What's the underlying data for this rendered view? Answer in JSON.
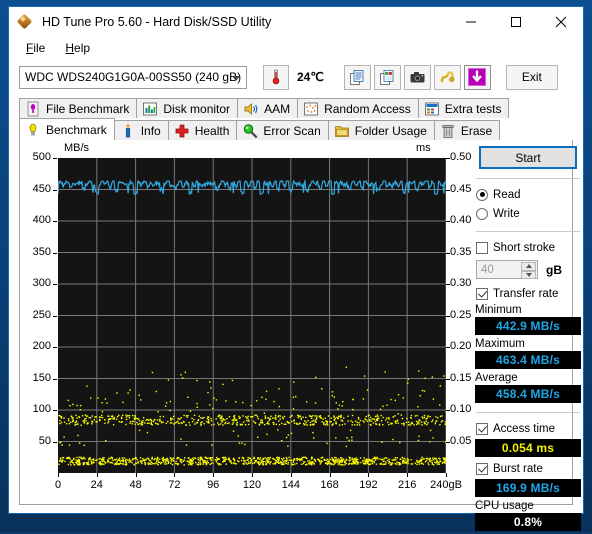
{
  "window": {
    "title": "HD Tune Pro 5.60 - Hard Disk/SSD Utility",
    "app_icon": "hdtune-diamond-icon",
    "minimize_label": "─",
    "maximize_label": "□",
    "close_label": "×"
  },
  "menu": [
    {
      "label": "File",
      "accel": "F"
    },
    {
      "label": "Help",
      "accel": "H"
    }
  ],
  "toolbar": {
    "drive": "WDC WDS240G1G0A-00SS50 (240 gB)",
    "temperature": "24℃",
    "exit_label": "Exit",
    "icons": [
      "copy-text-icon",
      "copy-image-icon",
      "screenshot-camera-icon",
      "cable-icon",
      "download-arrow-icon"
    ]
  },
  "tabs": {
    "row1": [
      {
        "label": "File Benchmark",
        "icon": "file-benchmark-icon",
        "active": false
      },
      {
        "label": "Disk monitor",
        "icon": "disk-monitor-icon",
        "active": false
      },
      {
        "label": "AAM",
        "icon": "aam-speaker-icon",
        "active": false
      },
      {
        "label": "Random Access",
        "icon": "random-access-icon",
        "active": false
      },
      {
        "label": "Extra tests",
        "icon": "extra-tests-icon",
        "active": false
      }
    ],
    "row2": [
      {
        "label": "Benchmark",
        "icon": "benchmark-bulb-icon",
        "active": true
      },
      {
        "label": "Info",
        "icon": "info-icon",
        "active": false
      },
      {
        "label": "Health",
        "icon": "health-cross-icon",
        "active": false
      },
      {
        "label": "Error Scan",
        "icon": "error-scan-magnifier-icon",
        "active": false
      },
      {
        "label": "Folder Usage",
        "icon": "folder-usage-icon",
        "active": false
      },
      {
        "label": "Erase",
        "icon": "erase-trash-icon",
        "active": false
      }
    ]
  },
  "panel": {
    "start_label": "Start",
    "read_label": "Read",
    "write_label": "Write",
    "read_selected": true,
    "write_selected": false,
    "short_stroke_label": "Short stroke",
    "short_stroke_checked": false,
    "short_stroke_value": "40",
    "short_stroke_unit": "gB",
    "transfer_rate_label": "Transfer rate",
    "transfer_rate_checked": true,
    "minimum_label": "Minimum",
    "minimum_value": "442.9 MB/s",
    "maximum_label": "Maximum",
    "maximum_value": "463.4 MB/s",
    "average_label": "Average",
    "average_value": "458.4 MB/s",
    "access_time_label": "Access time",
    "access_time_checked": true,
    "access_time_value": "0.054 ms",
    "burst_rate_label": "Burst rate",
    "burst_rate_checked": true,
    "burst_rate_value": "169.9 MB/s",
    "cpu_usage_label": "CPU usage",
    "cpu_usage_value": "0.8%"
  },
  "colors": {
    "transfer_line": "#33a8e0",
    "access_dots": "#ffff00",
    "plot_background": "#141414",
    "grid": "#777777",
    "accent": "#0a6ebd",
    "value_text": "#1ea7e8"
  },
  "chart_data": {
    "type": "line",
    "title": "",
    "xlabel": "gB",
    "ylabel": "MB/s",
    "y2label": "ms",
    "xlim": [
      0,
      240
    ],
    "ylim": [
      0,
      500
    ],
    "y2lim": [
      0,
      0.5
    ],
    "grid": true,
    "legend": "none",
    "x_ticks": [
      0,
      24,
      48,
      72,
      96,
      120,
      144,
      168,
      192,
      216,
      240
    ],
    "x_tick_labels": [
      "0",
      "24",
      "48",
      "72",
      "96",
      "120",
      "144",
      "168",
      "192",
      "216",
      "240gB"
    ],
    "y_ticks": [
      50,
      100,
      150,
      200,
      250,
      300,
      350,
      400,
      450,
      500
    ],
    "y_tick_labels": [
      "50",
      "100",
      "150",
      "200",
      "250",
      "300",
      "350",
      "400",
      "450",
      "500"
    ],
    "y2_ticks": [
      0.05,
      0.1,
      0.15,
      0.2,
      0.25,
      0.3,
      0.35,
      0.4,
      0.45,
      0.5
    ],
    "y2_tick_labels": [
      "0.05",
      "0.10",
      "0.15",
      "0.20",
      "0.25",
      "0.30",
      "0.35",
      "0.40",
      "0.45",
      "0.50"
    ],
    "series": [
      {
        "name": "Transfer rate",
        "type": "line",
        "axis": "left",
        "color": "#33a8e0",
        "unit": "MB/s",
        "summary": {
          "minimum": 442.9,
          "maximum": 463.4,
          "average": 458.4
        },
        "x": [
          0,
          2,
          4,
          6,
          8,
          10,
          12,
          14,
          16,
          18,
          20,
          22,
          24,
          26,
          28,
          30,
          32,
          34,
          36,
          38,
          40,
          42,
          44,
          46,
          48,
          50,
          52,
          54,
          56,
          58,
          60,
          62,
          64,
          66,
          68,
          70,
          72,
          74,
          76,
          78,
          80,
          82,
          84,
          86,
          88,
          90,
          92,
          94,
          96,
          98,
          100,
          102,
          104,
          106,
          108,
          110,
          112,
          114,
          116,
          118,
          120,
          122,
          124,
          126,
          128,
          130,
          132,
          134,
          136,
          138,
          140,
          142,
          144,
          146,
          148,
          150,
          152,
          154,
          156,
          158,
          160,
          162,
          164,
          166,
          168,
          170,
          172,
          174,
          176,
          178,
          180,
          182,
          184,
          186,
          188,
          190,
          192,
          194,
          196,
          198,
          200,
          202,
          204,
          206,
          208,
          210,
          212,
          214,
          216,
          218,
          220,
          222,
          224,
          226,
          228,
          230,
          232,
          234,
          236,
          238,
          240
        ],
        "y": [
          459,
          462,
          457,
          463,
          452,
          461,
          458,
          463,
          449,
          460,
          462,
          457,
          444,
          458,
          463,
          461,
          455,
          462,
          450,
          459,
          463,
          456,
          461,
          458,
          443,
          462,
          459,
          463,
          454,
          460,
          457,
          462,
          448,
          461,
          463,
          458,
          452,
          459,
          462,
          456,
          461,
          443,
          458,
          463,
          460,
          455,
          462,
          457,
          461,
          449,
          458,
          463,
          459,
          452,
          461,
          457,
          463,
          446,
          460,
          458,
          462,
          455,
          461,
          443,
          459,
          463,
          457,
          460,
          452,
          462,
          458,
          463,
          450,
          459,
          461,
          456,
          462,
          447,
          458,
          463,
          460,
          453,
          461,
          458,
          462,
          444,
          459,
          463,
          457,
          460,
          451,
          462,
          458,
          461,
          454,
          463,
          459,
          457,
          462,
          448,
          460,
          463,
          458,
          455,
          461,
          457,
          462,
          446,
          459,
          463,
          460,
          452,
          458,
          461,
          463,
          456,
          459,
          443,
          461,
          458,
          460
        ]
      },
      {
        "name": "Access time",
        "type": "scatter",
        "axis": "right",
        "color": "#ffff00",
        "unit": "ms",
        "summary": {
          "average": 0.054
        },
        "description": "Dense scatter band near 0.02 ms and a second band near 0.085 ms, with sparse outliers up to about 0.16 ms across the full 0-240 gB span.",
        "bands": [
          {
            "center_ms": 0.02,
            "spread_ms": 0.006,
            "density": "high"
          },
          {
            "center_ms": 0.085,
            "spread_ms": 0.008,
            "density": "medium"
          }
        ],
        "outliers_ms": [
          0.16,
          0.135,
          0.125,
          0.12,
          0.118,
          0.115,
          0.112,
          0.11,
          0.108,
          0.105,
          0.1,
          0.065,
          0.06,
          0.055,
          0.05,
          0.045
        ]
      }
    ]
  }
}
